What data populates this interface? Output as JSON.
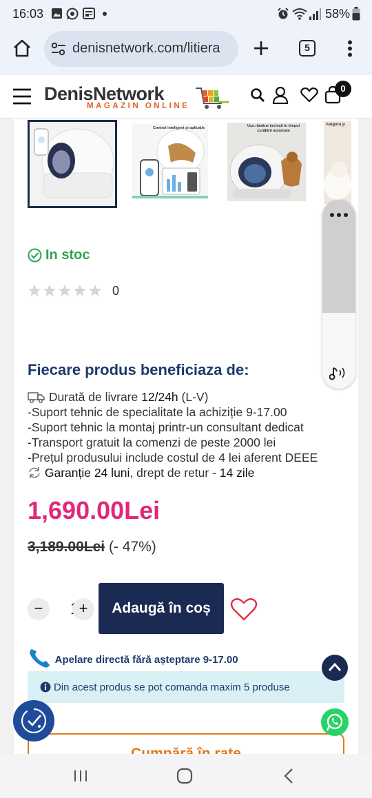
{
  "status_bar": {
    "time": "16:03",
    "battery_percent": "58%",
    "icons": [
      "image-icon",
      "whatsapp-icon",
      "news-icon",
      "dot-icon",
      "alarm-icon",
      "wifi-icon",
      "signal-icon",
      "battery-icon"
    ]
  },
  "browser": {
    "url": "denisnetwork.com/litiera",
    "tab_count": "5",
    "icons": [
      "home-icon",
      "site-settings-icon",
      "new-tab-icon",
      "tabs-icon",
      "more-menu-icon"
    ]
  },
  "header": {
    "logo_word": "DenisNetwork",
    "logo_sub": "MAGAZIN ONLINE",
    "cart_count": "0",
    "icons": [
      "hamburger-menu-icon",
      "search-icon",
      "account-icon",
      "wishlist-icon",
      "cart-icon"
    ]
  },
  "product": {
    "stock_label": "In stoc",
    "rating_count": "0",
    "stars_filled": 0,
    "stars_total": 5,
    "thumbnails": [
      {
        "caption": ""
      },
      {
        "caption": "Control inteligent și aplicație"
      },
      {
        "caption": "Ușa rămâne închisă în timpul curățării automate"
      },
      {
        "caption": "Asigură p"
      }
    ],
    "benefits_title": "Fiecare produs beneficiaza de:",
    "delivery_prefix": "Durată de livrare",
    "delivery_value": "12/24h",
    "delivery_suffix": "(L-V)",
    "benefit_lines": [
      "-Suport tehnic de specialitate la achiziție 9-17.00",
      "-Suport tehnic la montaj printr-un consultant dedicat",
      "-Transport gratuit la comenzi de peste 2000 lei",
      "-Prețul produsului include costul de 4 lei aferent DEEE"
    ],
    "warranty_value": "Garanție 24 luni",
    "warranty_middle": ", drept de retur -",
    "return_days": "14 zile",
    "price": "1,690.00Lei",
    "old_price": "3,189.00Lei",
    "discount": "(- 47%)",
    "quantity": "1",
    "qty_minus": "−",
    "qty_plus": "+",
    "add_to_cart": "Adaugă în coș",
    "call_line": "Apelare directă fără așteptare 9-17.00",
    "max_info": "Din acest produs se pot comanda maxim 5 produse",
    "installments": "Cumpără în rate"
  },
  "colors": {
    "accent_navy": "#1b2a52",
    "price_pink": "#e0287a",
    "stock_green": "#2ea44f",
    "installments_orange": "#e07a1f",
    "info_bg": "#d9f0f5"
  }
}
